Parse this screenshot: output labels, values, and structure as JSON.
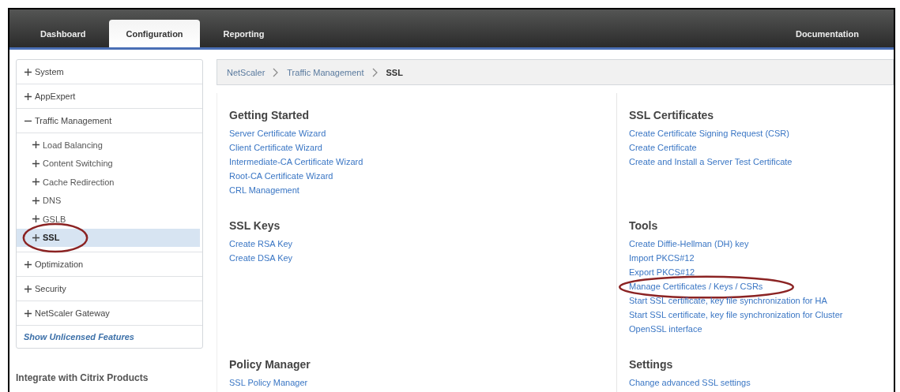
{
  "header": {
    "tabs": [
      {
        "label": "Dashboard",
        "selected": false
      },
      {
        "label": "Configuration",
        "selected": true
      },
      {
        "label": "Reporting",
        "selected": false
      }
    ],
    "right_link": "Documentation"
  },
  "sidebar": {
    "items": [
      {
        "label": "System",
        "expanded": false
      },
      {
        "label": "AppExpert",
        "expanded": false
      },
      {
        "label": "Traffic Management",
        "expanded": true,
        "children": [
          {
            "label": "Load Balancing",
            "selected": false,
            "circled": false
          },
          {
            "label": "Content Switching",
            "selected": false,
            "circled": false
          },
          {
            "label": "Cache Redirection",
            "selected": false,
            "circled": false
          },
          {
            "label": "DNS",
            "selected": false,
            "circled": false
          },
          {
            "label": "GSLB",
            "selected": false,
            "circled": false
          },
          {
            "label": "SSL",
            "selected": true,
            "circled": true
          }
        ]
      },
      {
        "label": "Optimization",
        "expanded": false
      },
      {
        "label": "Security",
        "expanded": false
      },
      {
        "label": "NetScaler Gateway",
        "expanded": false
      }
    ],
    "footer_link": "Show Unlicensed Features",
    "section_title": "Integrate with Citrix Products"
  },
  "breadcrumb": [
    "NetScaler",
    "Traffic Management",
    "SSL"
  ],
  "section_rows": [
    [
      {
        "title": "Getting Started",
        "links": [
          {
            "label": "Server Certificate Wizard",
            "circled": false
          },
          {
            "label": "Client Certificate Wizard",
            "circled": false
          },
          {
            "label": "Intermediate-CA Certificate Wizard",
            "circled": false
          },
          {
            "label": "Root-CA Certificate Wizard",
            "circled": false
          },
          {
            "label": "CRL Management",
            "circled": false
          }
        ]
      },
      {
        "title": "SSL Certificates",
        "links": [
          {
            "label": "Create Certificate Signing Request (CSR)",
            "circled": false
          },
          {
            "label": "Create Certificate",
            "circled": false
          },
          {
            "label": "Create and Install a Server Test Certificate",
            "circled": false
          }
        ]
      }
    ],
    [
      {
        "title": "SSL Keys",
        "links": [
          {
            "label": "Create RSA Key",
            "circled": false
          },
          {
            "label": "Create DSA Key",
            "circled": false
          }
        ]
      },
      {
        "title": "Tools",
        "links": [
          {
            "label": "Create Diffie-Hellman (DH) key",
            "circled": false
          },
          {
            "label": "Import PKCS#12",
            "circled": false
          },
          {
            "label": "Export PKCS#12",
            "circled": false
          },
          {
            "label": "Manage Certificates / Keys / CSRs",
            "circled": true
          },
          {
            "label": "Start SSL certificate, key file synchronization for HA",
            "circled": false
          },
          {
            "label": "Start SSL certificate, key file synchronization for Cluster",
            "circled": false
          },
          {
            "label": "OpenSSL interface",
            "circled": false
          }
        ]
      }
    ],
    [
      {
        "title": "Policy Manager",
        "links": [
          {
            "label": "SSL Policy Manager",
            "circled": false
          }
        ]
      },
      {
        "title": "Settings",
        "links": [
          {
            "label": "Change advanced SSL settings",
            "circled": false
          }
        ]
      }
    ]
  ]
}
